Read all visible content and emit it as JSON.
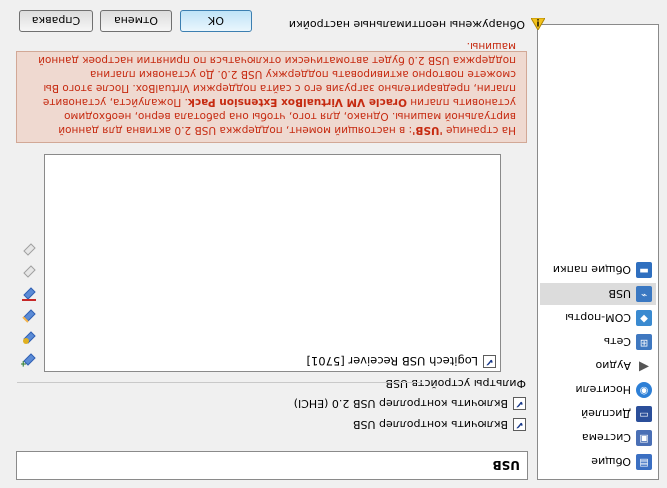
{
  "sidebar": {
    "items": [
      {
        "label": "Общие",
        "icon": "general-icon",
        "color": "#3b6fc2",
        "selected": false
      },
      {
        "label": "Система",
        "icon": "system-icon",
        "color": "#4a6fb5",
        "selected": false
      },
      {
        "label": "Дисплей",
        "icon": "display-icon",
        "color": "#2b4f9a",
        "selected": false
      },
      {
        "label": "Носители",
        "icon": "storage-icon",
        "color": "#2d7fd6",
        "selected": false
      },
      {
        "label": "Аудио",
        "icon": "audio-icon",
        "color": "#555555",
        "selected": false
      },
      {
        "label": "Сеть",
        "icon": "network-icon",
        "color": "#3f78c0",
        "selected": false
      },
      {
        "label": "COM-порты",
        "icon": "com-ports-icon",
        "color": "#3a8ad0",
        "selected": false
      },
      {
        "label": "USB",
        "icon": "usb-icon",
        "color": "#3a78c2",
        "selected": true
      },
      {
        "label": "Общие папки",
        "icon": "shared-folders-icon",
        "color": "#2f6fbf",
        "selected": false
      }
    ]
  },
  "page": {
    "title": "USB",
    "enable_usb": {
      "label": "Включить контроллер USB",
      "checked": true
    },
    "enable_usb2": {
      "label": "Включить контроллер USB 2.0 (EHCI)",
      "checked": true
    },
    "filters_label": "Фильтры устройств USB",
    "filters": [
      {
        "label": "Logitech USB Receiver [5701]",
        "checked": true
      }
    ],
    "filter_tools": [
      {
        "name": "add-filter-icon",
        "glyph": "✚",
        "color": "#2e7d32"
      },
      {
        "name": "add-from-device-icon",
        "glyph": "✚",
        "color": "#d9a400"
      },
      {
        "name": "edit-filter-icon",
        "glyph": "✎",
        "color": "#2f5fb3"
      },
      {
        "name": "remove-filter-icon",
        "glyph": "✖",
        "color": "#c62828"
      },
      {
        "name": "move-up-icon",
        "glyph": "▲",
        "color": "#9e9e9e"
      },
      {
        "name": "move-down-icon",
        "glyph": "▼",
        "color": "#9e9e9e"
      }
    ]
  },
  "warning": {
    "p1": "На странице ",
    "p2": "'USB'",
    "p3": ": в настоящий момент, поддержка USB 2.0 активна для данной виртуальной машины. Однако, для того, чтобы она работала верно, необходимо установить плагин ",
    "p4": "Oracle VM VirtualBox Extension Pack",
    "p5": ". Пожалуйста, установите плагин, предварительно загрузив его с сайта поддержки VirtualBox. После этого Вы сможете повторно активировать поддержку USB 2.0. До установки плагина поддержка USB 2.0 будет автоматически отключаться по принятии настроек данной машины.",
    "color": "#c62a10"
  },
  "footer": {
    "status": "Обнаружены неоптимальные настройки",
    "ok": "OK",
    "cancel": "Отмена",
    "help": "Справка"
  }
}
